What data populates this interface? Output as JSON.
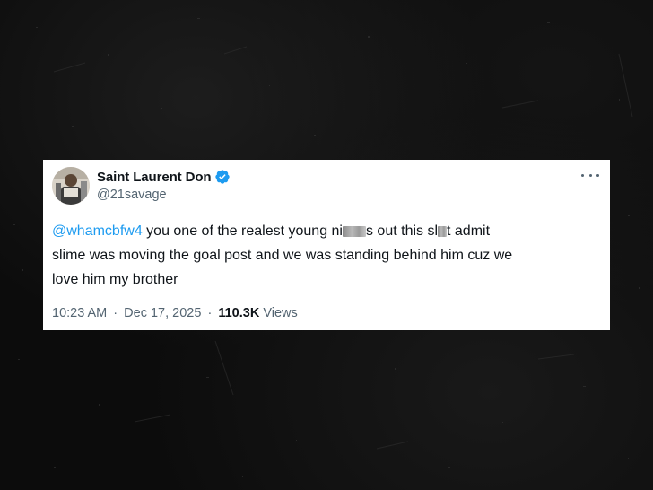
{
  "tweet": {
    "display_name": "Saint Laurent Don",
    "handle": "@21savage",
    "verified": true,
    "mention": "@whamcbfw4",
    "text_part_1": " you one of the realest young ni",
    "text_part_2": "s out this sl",
    "text_part_3": "t admit",
    "text_line_2": "slime was moving the goal post and we was standing behind him cuz we",
    "text_line_3": "love him my brother",
    "time": "10:23 AM",
    "separator": "·",
    "date": "Dec 17, 2025",
    "views_count": "110.3K",
    "views_label": "Views"
  },
  "colors": {
    "background": "#0c0c0c",
    "card": "#ffffff",
    "text": "#0f1419",
    "secondary": "#536471",
    "accent": "#1d9bf0"
  },
  "icons": {
    "verified": "verified-badge-icon",
    "more": "more-options-icon",
    "avatar": "profile-avatar"
  }
}
